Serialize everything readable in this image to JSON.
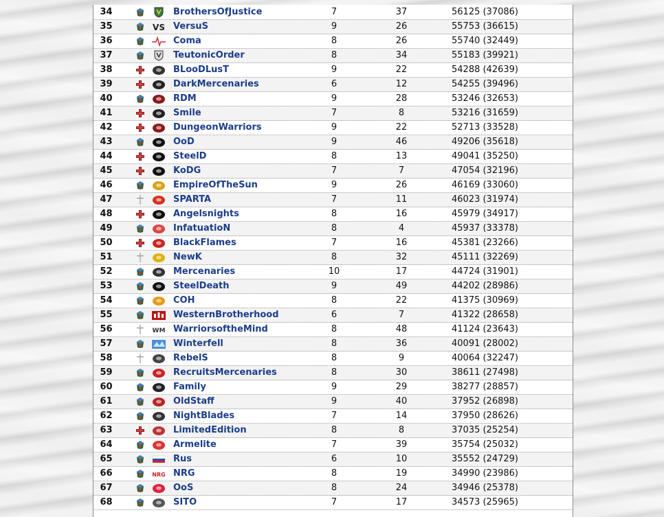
{
  "rows": [
    {
      "rank": "34",
      "race": "mix",
      "logo": "shield-v",
      "name": "BrothersOfJustice",
      "c1": "7",
      "c2": "37",
      "c3": "56125 (37086)"
    },
    {
      "rank": "35",
      "race": "mix",
      "logo": "vs",
      "name": "VersuS",
      "c1": "9",
      "c2": "26",
      "c3": "55753 (36615)"
    },
    {
      "rank": "36",
      "race": "mix",
      "logo": "pulse",
      "name": "Coma",
      "c1": "8",
      "c2": "26",
      "c3": "55740 (32449)"
    },
    {
      "rank": "37",
      "race": "mix",
      "logo": "shield",
      "name": "TeutonicOrder",
      "c1": "8",
      "c2": "34",
      "c3": "55183 (39921)"
    },
    {
      "rank": "38",
      "race": "cross",
      "logo": "claw",
      "name": "BLooDLusT",
      "c1": "9",
      "c2": "22",
      "c3": "54288 (42639)"
    },
    {
      "rank": "39",
      "race": "cross",
      "logo": "beast",
      "name": "DarkMercenaries",
      "c1": "6",
      "c2": "12",
      "c3": "54255 (39496)"
    },
    {
      "rank": "40",
      "race": "mix",
      "logo": "horns",
      "name": "RDM",
      "c1": "9",
      "c2": "28",
      "c3": "53246 (32653)"
    },
    {
      "rank": "41",
      "race": "cross",
      "logo": "face",
      "name": "Smile",
      "c1": "7",
      "c2": "8",
      "c3": "53216 (31659)"
    },
    {
      "rank": "42",
      "race": "cross",
      "logo": "ram",
      "name": "DungeonWarriors",
      "c1": "9",
      "c2": "22",
      "c3": "52713 (33528)"
    },
    {
      "rank": "43",
      "race": "mix",
      "logo": "circle-a",
      "name": "OoD",
      "c1": "9",
      "c2": "46",
      "c3": "49206 (35618)"
    },
    {
      "rank": "44",
      "race": "cross",
      "logo": "wolf",
      "name": "SteelD",
      "c1": "8",
      "c2": "13",
      "c3": "49041 (35250)"
    },
    {
      "rank": "45",
      "race": "cross",
      "logo": "dragon",
      "name": "KoDG",
      "c1": "7",
      "c2": "7",
      "c3": "47054 (32196)"
    },
    {
      "rank": "46",
      "race": "mix",
      "logo": "sun",
      "name": "EmpireOfTheSun",
      "c1": "9",
      "c2": "26",
      "c3": "46169 (33060)"
    },
    {
      "rank": "47",
      "race": "sword",
      "logo": "super",
      "name": "SPARTA",
      "c1": "7",
      "c2": "11",
      "c3": "46023 (31974)"
    },
    {
      "rank": "48",
      "race": "cross",
      "logo": "cross-star",
      "name": "Angelsnights",
      "c1": "8",
      "c2": "16",
      "c3": "45979 (34917)"
    },
    {
      "rank": "49",
      "race": "mix",
      "logo": "heart",
      "name": "InfatuatioN",
      "c1": "8",
      "c2": "4",
      "c3": "45937 (33378)"
    },
    {
      "rank": "50",
      "race": "cross",
      "logo": "flame",
      "name": "BlackFlames",
      "c1": "7",
      "c2": "16",
      "c3": "45381 (23266)"
    },
    {
      "rank": "51",
      "race": "sword",
      "logo": "horse",
      "name": "NewK",
      "c1": "8",
      "c2": "32",
      "c3": "45111 (32269)"
    },
    {
      "rank": "52",
      "race": "mix",
      "logo": "wing",
      "name": "Mercenaries",
      "c1": "10",
      "c2": "17",
      "c3": "44724 (31901)"
    },
    {
      "rank": "53",
      "race": "mix",
      "logo": "drop",
      "name": "SteelDeath",
      "c1": "9",
      "c2": "49",
      "c3": "44202 (28986)"
    },
    {
      "rank": "54",
      "race": "mix",
      "logo": "orange",
      "name": "COH",
      "c1": "8",
      "c2": "22",
      "c3": "41375 (30969)"
    },
    {
      "rank": "55",
      "race": "mix",
      "logo": "castle",
      "name": "WesternBrotherhood",
      "c1": "6",
      "c2": "7",
      "c3": "41322 (28658)"
    },
    {
      "rank": "56",
      "race": "sword",
      "logo": "wm",
      "name": "WarriorsoftheMind",
      "c1": "8",
      "c2": "48",
      "c3": "41124 (23643)"
    },
    {
      "rank": "57",
      "race": "mix",
      "logo": "ice",
      "name": "Winterfell",
      "c1": "8",
      "c2": "36",
      "c3": "40091 (28002)"
    },
    {
      "rank": "58",
      "race": "sword",
      "logo": "wings",
      "name": "RebelS",
      "c1": "8",
      "c2": "9",
      "c3": "40064 (32247)"
    },
    {
      "rank": "59",
      "race": "mix",
      "logo": "r",
      "name": "RecruitsMercenaries",
      "c1": "8",
      "c2": "30",
      "c3": "38611 (27498)"
    },
    {
      "rank": "60",
      "race": "mix",
      "logo": "swirl",
      "name": "Family",
      "c1": "9",
      "c2": "29",
      "c3": "38277 (28857)"
    },
    {
      "rank": "61",
      "race": "mix",
      "logo": "crest",
      "name": "OldStaff",
      "c1": "9",
      "c2": "40",
      "c3": "37952 (26898)"
    },
    {
      "rank": "62",
      "race": "mix",
      "logo": "wreath",
      "name": "NightBlades",
      "c1": "7",
      "c2": "14",
      "c3": "37950 (28626)"
    },
    {
      "rank": "63",
      "race": "cross",
      "logo": "cross",
      "name": "LimitedEdition",
      "c1": "8",
      "c2": "8",
      "c3": "37035 (25254)"
    },
    {
      "rank": "64",
      "race": "mix",
      "logo": "apple",
      "name": "Armelite",
      "c1": "7",
      "c2": "39",
      "c3": "35754 (25032)"
    },
    {
      "rank": "65",
      "race": "mix",
      "logo": "flag-ru",
      "name": "Rus",
      "c1": "6",
      "c2": "10",
      "c3": "35552 (24729)"
    },
    {
      "rank": "66",
      "race": "mix",
      "logo": "nrg",
      "name": "NRG",
      "c1": "8",
      "c2": "19",
      "c3": "34990 (23986)"
    },
    {
      "rank": "67",
      "race": "mix",
      "logo": "fox",
      "name": "OoS",
      "c1": "8",
      "c2": "24",
      "c3": "34946 (25378)"
    },
    {
      "rank": "68",
      "race": "mix",
      "logo": "skull",
      "name": "SITO",
      "c1": "7",
      "c2": "17",
      "c3": "34573 (25965)"
    }
  ]
}
